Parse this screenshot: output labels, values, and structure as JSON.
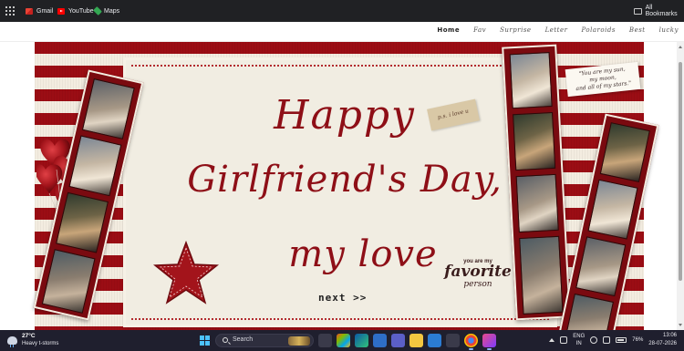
{
  "bookmarks_bar": {
    "items": [
      {
        "label": "Gmail",
        "icon": "gmail-icon"
      },
      {
        "label": "YouTube",
        "icon": "youtube-icon"
      },
      {
        "label": "Maps",
        "icon": "maps-icon"
      }
    ],
    "all_bookmarks_label": "All Bookmarks"
  },
  "site_nav": {
    "items": [
      "Home",
      "Fav",
      "Surprise",
      "Letter",
      "Polaroids",
      "Best",
      "lucky"
    ],
    "active": "Home"
  },
  "hero": {
    "headline_line1": "Happy",
    "headline_line2": "Girlfriend's Day,",
    "headline_line3": "my love",
    "next_label": "next >>",
    "tag_text": "p.s. i love u",
    "quote_line1": "\"You are my sun,",
    "quote_line2": "my moon,",
    "quote_line3": "and all of my stars.\"",
    "favorite_top": "you are my",
    "favorite_big": "favorite",
    "favorite_bottom": "person"
  },
  "colors": {
    "accent_red": "#9b0d14",
    "paper": "#f1ede2",
    "stripe_light": "#f3ece0",
    "headline": "#8e0f17"
  },
  "taskbar": {
    "weather_temp": "27°C",
    "weather_desc": "Heavy t-storms",
    "search_label": "Search",
    "lang_line1": "ENG",
    "lang_line2": "IN",
    "battery": "76%",
    "time": "13:06",
    "date": "28-07-2026"
  }
}
